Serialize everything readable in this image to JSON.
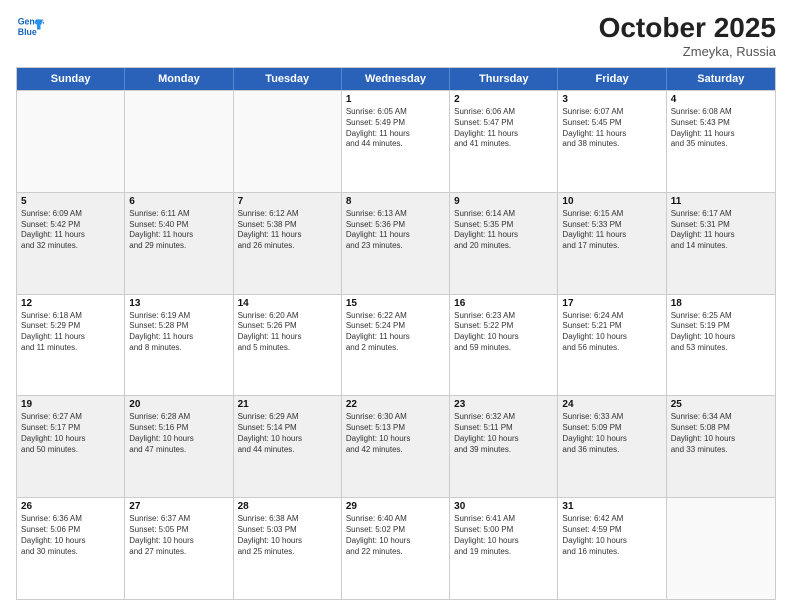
{
  "logo": {
    "line1": "General",
    "line2": "Blue"
  },
  "header": {
    "month": "October 2025",
    "location": "Zmeyka, Russia"
  },
  "weekdays": [
    "Sunday",
    "Monday",
    "Tuesday",
    "Wednesday",
    "Thursday",
    "Friday",
    "Saturday"
  ],
  "rows": [
    [
      {
        "day": "",
        "info": "",
        "empty": true
      },
      {
        "day": "",
        "info": "",
        "empty": true
      },
      {
        "day": "",
        "info": "",
        "empty": true
      },
      {
        "day": "1",
        "info": "Sunrise: 6:05 AM\nSunset: 5:49 PM\nDaylight: 11 hours\nand 44 minutes."
      },
      {
        "day": "2",
        "info": "Sunrise: 6:06 AM\nSunset: 5:47 PM\nDaylight: 11 hours\nand 41 minutes."
      },
      {
        "day": "3",
        "info": "Sunrise: 6:07 AM\nSunset: 5:45 PM\nDaylight: 11 hours\nand 38 minutes."
      },
      {
        "day": "4",
        "info": "Sunrise: 6:08 AM\nSunset: 5:43 PM\nDaylight: 11 hours\nand 35 minutes."
      }
    ],
    [
      {
        "day": "5",
        "info": "Sunrise: 6:09 AM\nSunset: 5:42 PM\nDaylight: 11 hours\nand 32 minutes."
      },
      {
        "day": "6",
        "info": "Sunrise: 6:11 AM\nSunset: 5:40 PM\nDaylight: 11 hours\nand 29 minutes."
      },
      {
        "day": "7",
        "info": "Sunrise: 6:12 AM\nSunset: 5:38 PM\nDaylight: 11 hours\nand 26 minutes."
      },
      {
        "day": "8",
        "info": "Sunrise: 6:13 AM\nSunset: 5:36 PM\nDaylight: 11 hours\nand 23 minutes."
      },
      {
        "day": "9",
        "info": "Sunrise: 6:14 AM\nSunset: 5:35 PM\nDaylight: 11 hours\nand 20 minutes."
      },
      {
        "day": "10",
        "info": "Sunrise: 6:15 AM\nSunset: 5:33 PM\nDaylight: 11 hours\nand 17 minutes."
      },
      {
        "day": "11",
        "info": "Sunrise: 6:17 AM\nSunset: 5:31 PM\nDaylight: 11 hours\nand 14 minutes."
      }
    ],
    [
      {
        "day": "12",
        "info": "Sunrise: 6:18 AM\nSunset: 5:29 PM\nDaylight: 11 hours\nand 11 minutes."
      },
      {
        "day": "13",
        "info": "Sunrise: 6:19 AM\nSunset: 5:28 PM\nDaylight: 11 hours\nand 8 minutes."
      },
      {
        "day": "14",
        "info": "Sunrise: 6:20 AM\nSunset: 5:26 PM\nDaylight: 11 hours\nand 5 minutes."
      },
      {
        "day": "15",
        "info": "Sunrise: 6:22 AM\nSunset: 5:24 PM\nDaylight: 11 hours\nand 2 minutes."
      },
      {
        "day": "16",
        "info": "Sunrise: 6:23 AM\nSunset: 5:22 PM\nDaylight: 10 hours\nand 59 minutes."
      },
      {
        "day": "17",
        "info": "Sunrise: 6:24 AM\nSunset: 5:21 PM\nDaylight: 10 hours\nand 56 minutes."
      },
      {
        "day": "18",
        "info": "Sunrise: 6:25 AM\nSunset: 5:19 PM\nDaylight: 10 hours\nand 53 minutes."
      }
    ],
    [
      {
        "day": "19",
        "info": "Sunrise: 6:27 AM\nSunset: 5:17 PM\nDaylight: 10 hours\nand 50 minutes."
      },
      {
        "day": "20",
        "info": "Sunrise: 6:28 AM\nSunset: 5:16 PM\nDaylight: 10 hours\nand 47 minutes."
      },
      {
        "day": "21",
        "info": "Sunrise: 6:29 AM\nSunset: 5:14 PM\nDaylight: 10 hours\nand 44 minutes."
      },
      {
        "day": "22",
        "info": "Sunrise: 6:30 AM\nSunset: 5:13 PM\nDaylight: 10 hours\nand 42 minutes."
      },
      {
        "day": "23",
        "info": "Sunrise: 6:32 AM\nSunset: 5:11 PM\nDaylight: 10 hours\nand 39 minutes."
      },
      {
        "day": "24",
        "info": "Sunrise: 6:33 AM\nSunset: 5:09 PM\nDaylight: 10 hours\nand 36 minutes."
      },
      {
        "day": "25",
        "info": "Sunrise: 6:34 AM\nSunset: 5:08 PM\nDaylight: 10 hours\nand 33 minutes."
      }
    ],
    [
      {
        "day": "26",
        "info": "Sunrise: 6:36 AM\nSunset: 5:06 PM\nDaylight: 10 hours\nand 30 minutes."
      },
      {
        "day": "27",
        "info": "Sunrise: 6:37 AM\nSunset: 5:05 PM\nDaylight: 10 hours\nand 27 minutes."
      },
      {
        "day": "28",
        "info": "Sunrise: 6:38 AM\nSunset: 5:03 PM\nDaylight: 10 hours\nand 25 minutes."
      },
      {
        "day": "29",
        "info": "Sunrise: 6:40 AM\nSunset: 5:02 PM\nDaylight: 10 hours\nand 22 minutes."
      },
      {
        "day": "30",
        "info": "Sunrise: 6:41 AM\nSunset: 5:00 PM\nDaylight: 10 hours\nand 19 minutes."
      },
      {
        "day": "31",
        "info": "Sunrise: 6:42 AM\nSunset: 4:59 PM\nDaylight: 10 hours\nand 16 minutes."
      },
      {
        "day": "",
        "info": "",
        "empty": true
      }
    ]
  ]
}
